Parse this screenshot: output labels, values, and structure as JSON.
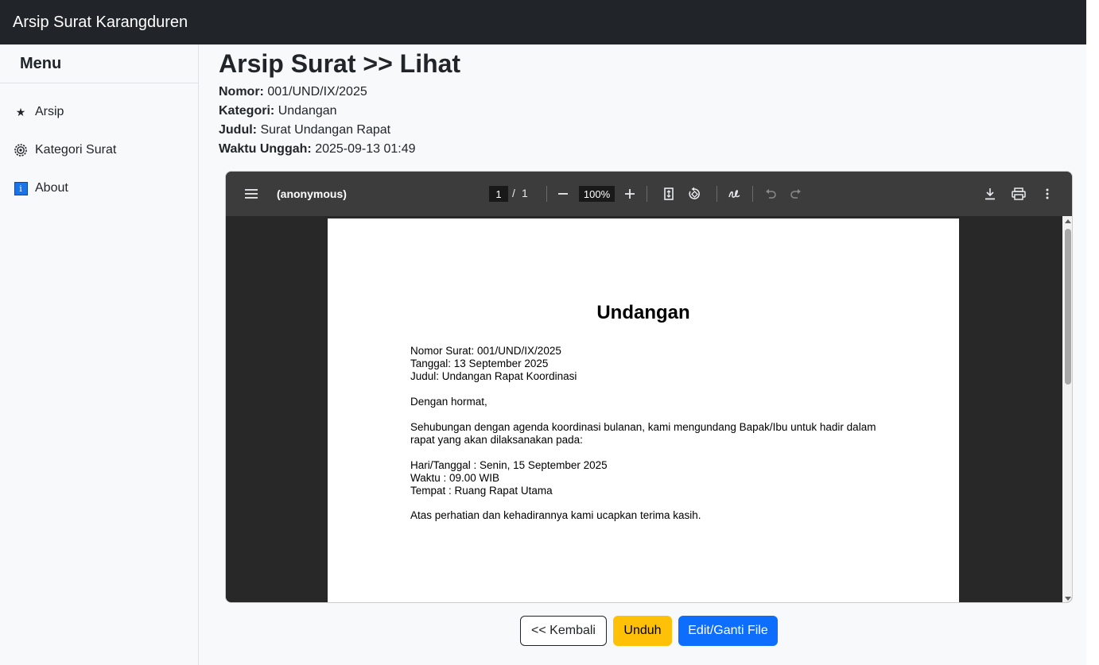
{
  "app": {
    "title": "Arsip Surat Karangduren"
  },
  "sidebar": {
    "header": "Menu",
    "items": [
      {
        "label": "Arsip",
        "icon": "star-icon",
        "glyph": "★"
      },
      {
        "label": "Kategori Surat",
        "icon": "gear-icon",
        "glyph": "⚙"
      },
      {
        "label": "About",
        "icon": "info-icon",
        "glyph": "i"
      }
    ]
  },
  "main": {
    "title": "Arsip Surat >> Lihat",
    "meta": [
      {
        "label": "Nomor:",
        "value": "001/UND/IX/2025"
      },
      {
        "label": "Kategori:",
        "value": "Undangan"
      },
      {
        "label": "Judul:",
        "value": "Surat Undangan Rapat"
      },
      {
        "label": "Waktu Unggah:",
        "value": "2025-09-13 01:49"
      }
    ]
  },
  "viewer": {
    "file_title": "(anonymous)",
    "page_current": "1",
    "page_separator": "/",
    "page_total": "1",
    "zoom": "100%",
    "icons": [
      "menu-icon",
      "zoom-out-icon",
      "zoom-in-icon",
      "fit-page-icon",
      "rotate-icon",
      "annotate-icon",
      "undo-icon",
      "redo-icon",
      "download-icon",
      "print-icon",
      "more-options-icon"
    ]
  },
  "document": {
    "heading": "Undangan",
    "lines": [
      "Nomor Surat: 001/UND/IX/2025",
      "Tanggal: 13 September 2025",
      "Judul: Undangan Rapat Koordinasi",
      "Dengan hormat,",
      "Sehubungan dengan agenda koordinasi bulanan, kami mengundang Bapak/Ibu untuk hadir dalam",
      "rapat yang akan dilaksanakan pada:",
      "Hari/Tanggal : Senin, 15 September 2025",
      "Waktu : 09.00 WIB",
      "Tempat : Ruang Rapat Utama",
      "Atas perhatian dan kehadirannya kami ucapkan terima kasih."
    ]
  },
  "actions": {
    "back": "<< Kembali",
    "download": "Unduh",
    "edit": "Edit/Ganti File"
  },
  "colors": {
    "navbar": "#212529",
    "warning": "#ffc107",
    "primary": "#0d6efd"
  }
}
